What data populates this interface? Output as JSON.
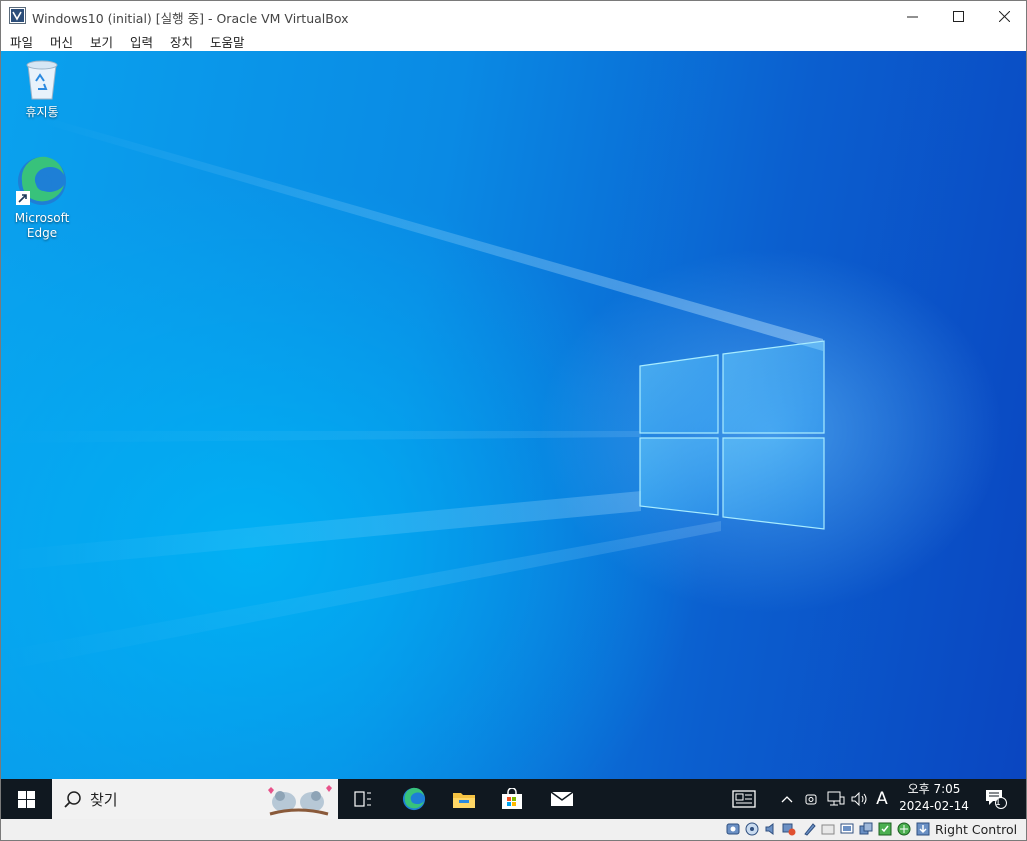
{
  "window": {
    "title": "Windows10 (initial) [실행 중] - Oracle VM VirtualBox",
    "controls": [
      "minimize",
      "maximize",
      "close"
    ]
  },
  "menubar": {
    "items": [
      "파일",
      "머신",
      "보기",
      "입력",
      "장치",
      "도움말"
    ]
  },
  "desktop": {
    "icons": [
      {
        "label": "휴지통",
        "icon": "recycle-bin-icon"
      },
      {
        "label": "Microsoft Edge",
        "icon": "edge-icon"
      }
    ]
  },
  "taskbar": {
    "start_icon": "windows-logo-icon",
    "search_placeholder": "찾기",
    "pinned": [
      "task-view-icon",
      "edge-icon",
      "file-explorer-icon",
      "store-icon",
      "mail-icon"
    ],
    "tray": {
      "ime": "A",
      "time": "오후 7:05",
      "date": "2024-02-14",
      "notification_count": "1"
    }
  },
  "statusbar": {
    "host_key": "Right Control",
    "icons": [
      "hard-disk-icon",
      "optical-disk-icon",
      "audio-icon",
      "network-icon",
      "usb-icon",
      "shared-folders-icon",
      "display-icon",
      "recording-icon",
      "capture-icon",
      "cpu-icon",
      "mouse-integration-icon",
      "keyboard-icon"
    ]
  },
  "colors": {
    "desktop_top": "#0b5fcf",
    "desktop_left": "#0aa2ee",
    "taskbar": "#101820",
    "accent_logo": "#7fd4ff"
  }
}
